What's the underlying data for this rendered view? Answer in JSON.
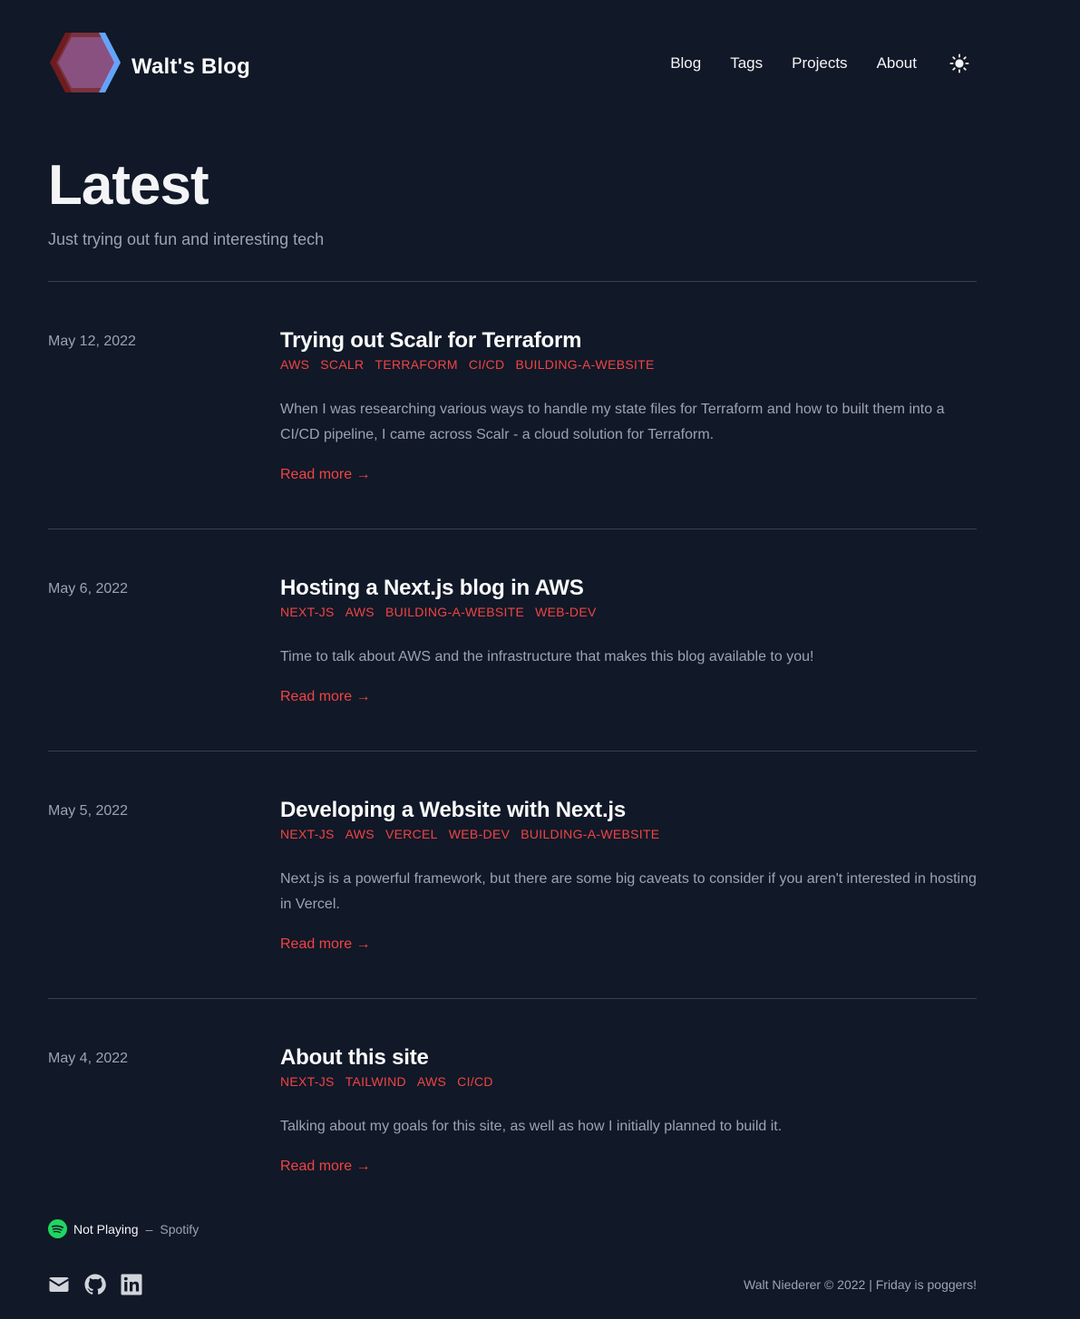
{
  "header": {
    "site_title": "Walt's Blog",
    "nav": [
      "Blog",
      "Tags",
      "Projects",
      "About"
    ]
  },
  "hero": {
    "title": "Latest",
    "subtitle": "Just trying out fun and interesting tech"
  },
  "posts": [
    {
      "date": "May 12, 2022",
      "title": "Trying out Scalr for Terraform",
      "tags": [
        "AWS",
        "SCALR",
        "TERRAFORM",
        "CI/CD",
        "BUILDING-A-WEBSITE"
      ],
      "summary": "When I was researching various ways to handle my state files for Terraform and how to built them into a CI/CD pipeline, I came across Scalr - a cloud solution for Terraform.",
      "read_more": "Read more →"
    },
    {
      "date": "May 6, 2022",
      "title": "Hosting a Next.js blog in AWS",
      "tags": [
        "NEXT-JS",
        "AWS",
        "BUILDING-A-WEBSITE",
        "WEB-DEV"
      ],
      "summary": "Time to talk about AWS and the infrastructure that makes this blog available to you!",
      "read_more": "Read more →"
    },
    {
      "date": "May 5, 2022",
      "title": "Developing a Website with Next.js",
      "tags": [
        "NEXT-JS",
        "AWS",
        "VERCEL",
        "WEB-DEV",
        "BUILDING-A-WEBSITE"
      ],
      "summary": "Next.js is a powerful framework, but there are some big caveats to consider if you aren't interested in hosting in Vercel.",
      "read_more": "Read more →"
    },
    {
      "date": "May 4, 2022",
      "title": "About this site",
      "tags": [
        "NEXT-JS",
        "TAILWIND",
        "AWS",
        "CI/CD"
      ],
      "summary": "Talking about my goals for this site, as well as how I initially planned to build it.",
      "read_more": "Read more →"
    }
  ],
  "footer": {
    "now_playing": "Not Playing",
    "dash": "–",
    "service": "Spotify",
    "copyright": "Walt Niederer © 2022 | Friday is poggers!"
  },
  "colors": {
    "background": "#111827",
    "accent": "#ef4444",
    "muted_text": "#9ca3af",
    "divider": "#374151"
  },
  "icons": [
    "logo-hexagon-icon",
    "sun-icon",
    "spotify-icon",
    "mail-icon",
    "github-icon",
    "linkedin-icon"
  ]
}
